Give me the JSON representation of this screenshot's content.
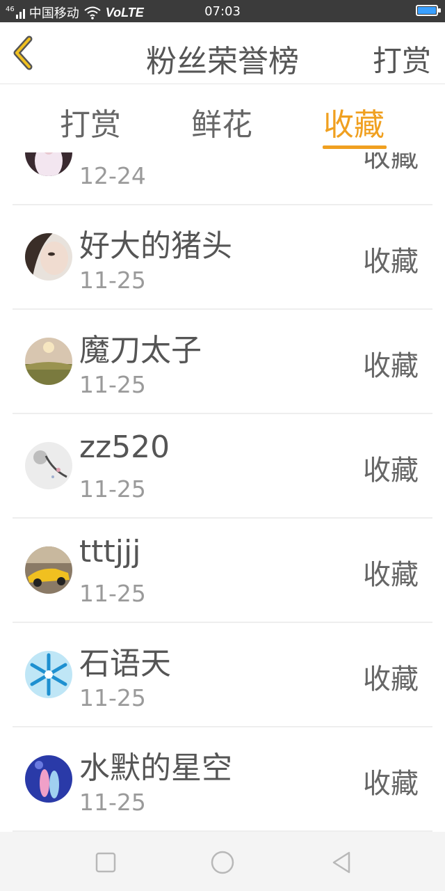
{
  "statusbar": {
    "signal": "46",
    "carrier": "中国移动",
    "volte": "VoLTE",
    "time": "07:03"
  },
  "header": {
    "title": "粉丝荣誉榜",
    "action": "打赏"
  },
  "tabs": [
    {
      "label": "打赏",
      "active": false
    },
    {
      "label": "鲜花",
      "active": false
    },
    {
      "label": "收藏",
      "active": true
    }
  ],
  "colors": {
    "accent": "#f0a020",
    "text": "#555555",
    "muted": "#9a9a9a"
  },
  "list": {
    "items": [
      {
        "name": "",
        "date": "12-24",
        "kind": "收藏"
      },
      {
        "name": "好大的猪头",
        "date": "11-25",
        "kind": "收藏"
      },
      {
        "name": "魔刀太子",
        "date": "11-25",
        "kind": "收藏"
      },
      {
        "name": "zz520",
        "date": "11-25",
        "kind": "收藏"
      },
      {
        "name": "tttjjj",
        "date": "11-25",
        "kind": "收藏"
      },
      {
        "name": "石语天",
        "date": "11-25",
        "kind": "收藏"
      },
      {
        "name": "水默的星空",
        "date": "11-25",
        "kind": "收藏"
      }
    ]
  },
  "navbar": {
    "icons": [
      "square-icon",
      "circle-icon",
      "triangle-back-icon"
    ]
  }
}
